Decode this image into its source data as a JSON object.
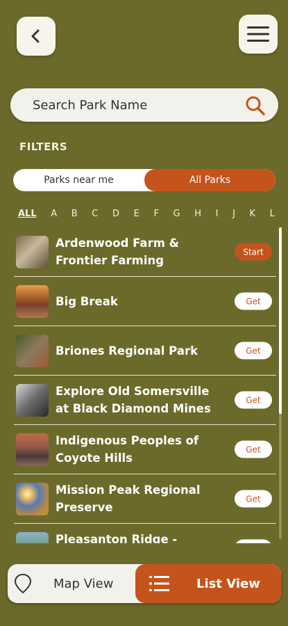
{
  "header": {
    "back_icon": "chevron-left-icon",
    "menu_icon": "hamburger-menu-icon"
  },
  "search": {
    "placeholder": "Search Park Name",
    "icon": "search-icon"
  },
  "filters": {
    "title": "FILTERS",
    "options": [
      "Parks near me",
      "All Parks"
    ],
    "selected": "All Parks"
  },
  "alphabet": [
    "ALL",
    "A",
    "B",
    "C",
    "D",
    "E",
    "F",
    "G",
    "H",
    "I",
    "J",
    "K",
    "L"
  ],
  "parks": [
    {
      "name": "Ardenwood Farm & Frontier Farming",
      "action": "Start"
    },
    {
      "name": "Big Break",
      "action": "Get"
    },
    {
      "name": "Briones Regional Park",
      "action": "Get"
    },
    {
      "name": "Explore Old Somersville at Black Diamond Mines",
      "action": "Get"
    },
    {
      "name": "Indigenous Peoples of Coyote Hills",
      "action": "Get"
    },
    {
      "name": "Mission Peak Regional Preserve",
      "action": "Get"
    },
    {
      "name": "Pleasanton Ridge - Ensured",
      "action": ""
    }
  ],
  "bottom_nav": {
    "map_view": "Map View",
    "list_view": "List View",
    "map_icon": "map-pin-icon",
    "list_icon": "list-icon"
  },
  "colors": {
    "background": "#6b6a2a",
    "accent": "#c4541c",
    "light": "#f3f1ec"
  }
}
